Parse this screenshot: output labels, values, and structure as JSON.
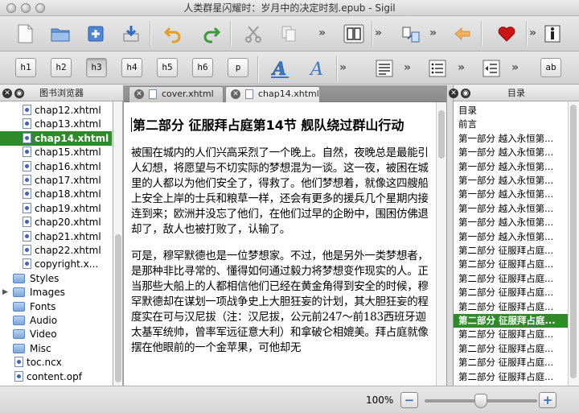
{
  "window": {
    "title": "人类群星闪耀时：岁月中的决定时刻.epub - Sigil"
  },
  "toolbar1": {
    "overflow_label": "»"
  },
  "heading_buttons": [
    "h1",
    "h2",
    "h3",
    "h4",
    "h5",
    "h6",
    "p"
  ],
  "active_heading": "h3",
  "toolbar2": {
    "ab_label": "ab"
  },
  "book_browser": {
    "title": "图书浏览器",
    "files": [
      "chap12.xhtml",
      "chap13.xhtml",
      "chap14.xhtml",
      "chap15.xhtml",
      "chap16.xhtml",
      "chap17.xhtml",
      "chap18.xhtml",
      "chap19.xhtml",
      "chap20.xhtml",
      "chap21.xhtml",
      "chap22.xhtml",
      "copyright.x..."
    ],
    "selected_file": "chap14.xhtml",
    "folders": [
      "Styles",
      "Images",
      "Fonts",
      "Audio",
      "Video",
      "Misc"
    ],
    "root_files": [
      "toc.ncx",
      "content.opf"
    ]
  },
  "tabs": [
    {
      "label": "cover.xhtml"
    },
    {
      "label": "chap14.xhtml"
    }
  ],
  "editor": {
    "heading": "第二部分 征服拜占庭第14节 舰队绕过群山行动",
    "paragraphs": [
      "被围在城内的人们兴高采烈了一个晚上。自然，夜晚总是最能引人幻想，将愿望与不切实际的梦想混为一谈。这一夜，被困在城里的人都以为他们安全了，得救了。他们梦想着，就像这四艘船上安全上岸的士兵和粮草一样，还会有更多的援兵几个星期内接连到来；欧洲并没忘了他们，在他们过早的企盼中，围困仿佛退却了，敌人也被打败了，认输了。",
      "可是，穆罕默德也是一位梦想家。不过，他是另外一类梦想者，是那种非比寻常的、懂得如何通过毅力将梦想变作现实的人。正当那些大船上的人都相信他们已经在黄金角得到安全的时候，穆罕默德却在谋划一项战争史上大胆狂妄的计划，其大胆狂妄的程度实在可与汉尼拔（注：汉尼拔，公元前247～前183西班牙迦太基军统帅，曾率军远征意大利）和拿破仑相媲美。拜占庭就像摆在他眼前的一个金苹果，可他却无"
    ]
  },
  "toc": {
    "title": "目录",
    "items": [
      "目录",
      "前言",
      "第一部分 越入永恒第...",
      "第一部分 越入永恒第...",
      "第一部分 越入永恒第...",
      "第一部分 越入永恒第...",
      "第一部分 越入永恒第...",
      "第一部分 越入永恒第...",
      "第一部分 越入永恒第...",
      "第一部分 越入永恒第...",
      "第二部分 征服拜占庭...",
      "第二部分 征服拜占庭...",
      "第二部分 征服拜占庭...",
      "第二部分 征服拜占庭...",
      "第二部分 征服拜占庭...",
      "第二部分 征服拜占庭...",
      "第二部分 征服拜占庭...",
      "第二部分 征服拜占庭...",
      "第二部分 征服拜占庭...",
      "第二部分 征服拜占庭...",
      "第三部分 亨德尔的复...",
      "第三部分 亨德尔的复..."
    ],
    "selected_index": 15
  },
  "statusbar": {
    "zoom": "100%",
    "zoom_level": 0.5,
    "minus": "−",
    "plus": "+"
  },
  "colors": {
    "selection": "#2f8a2a"
  }
}
